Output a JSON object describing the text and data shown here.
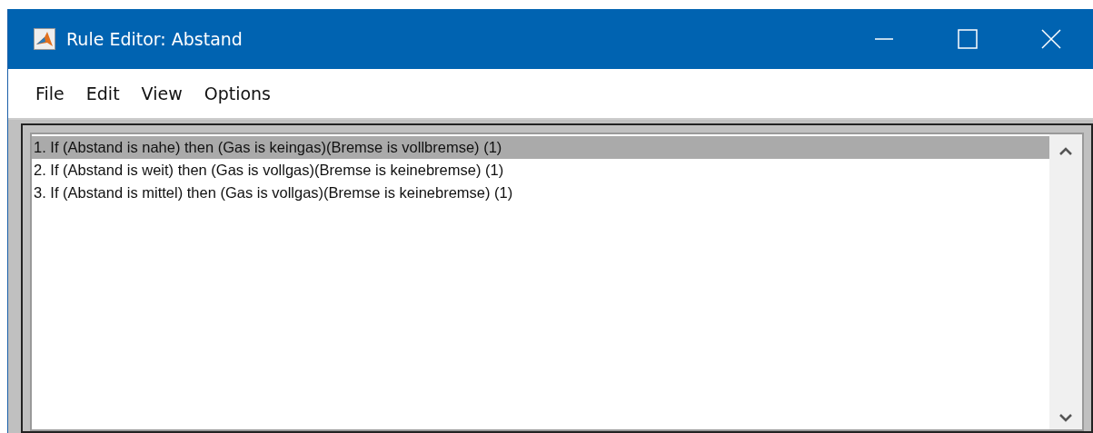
{
  "window": {
    "title": "Rule Editor: Abstand"
  },
  "menu": [
    "File",
    "Edit",
    "View",
    "Options"
  ],
  "rules": [
    {
      "text": "1. If (Abstand is nahe) then (Gas is keingas)(Bremse is vollbremse) (1)",
      "selected": true
    },
    {
      "text": "2. If (Abstand is weit) then (Gas is vollgas)(Bremse is keinebremse) (1)",
      "selected": false
    },
    {
      "text": "3. If (Abstand is mittel) then (Gas is vollgas)(Bremse is keinebremse) (1)",
      "selected": false
    }
  ]
}
